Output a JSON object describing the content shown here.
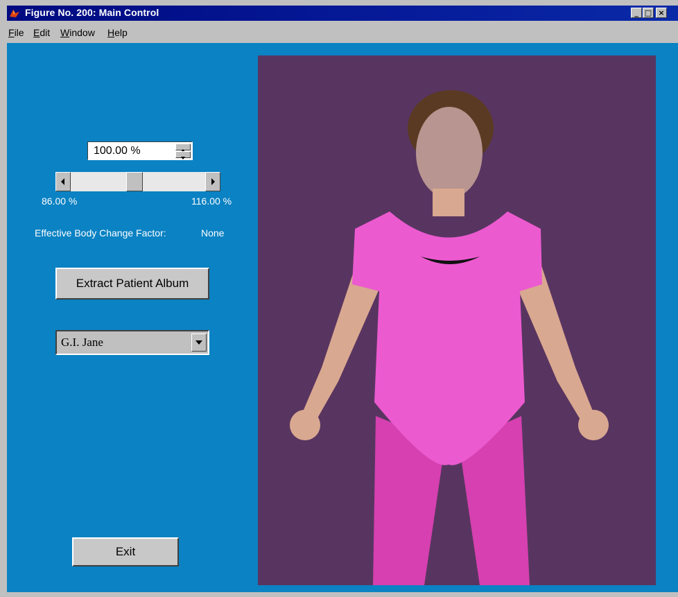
{
  "window": {
    "title": "Figure No. 200: Main Control",
    "controls": [
      "_",
      "□",
      "×"
    ]
  },
  "menu": [
    {
      "label": "File",
      "mnemonic": "F",
      "rest": "ile"
    },
    {
      "label": "Edit",
      "mnemonic": "E",
      "rest": "dit"
    },
    {
      "label": "Window",
      "mnemonic": "W",
      "rest": "indow"
    },
    {
      "label": "Help",
      "mnemonic": "H",
      "rest": "elp"
    }
  ],
  "controls": {
    "scale_value": "100.00 %",
    "slider": {
      "min_label": "86.00 %",
      "max_label": "116.00 %",
      "position_fraction": 0.5
    },
    "body_change_label": "Effective Body Change Factor:",
    "body_change_value": "None",
    "extract_button": "Extract Patient Album",
    "patient_select": "G.I. Jane",
    "exit_button": "Exit"
  },
  "image": {
    "description_icon": "patient-photo"
  },
  "colors": {
    "client_bg": "#0a82c3",
    "image_bg": "#583560",
    "title_bar": "#000a80"
  }
}
